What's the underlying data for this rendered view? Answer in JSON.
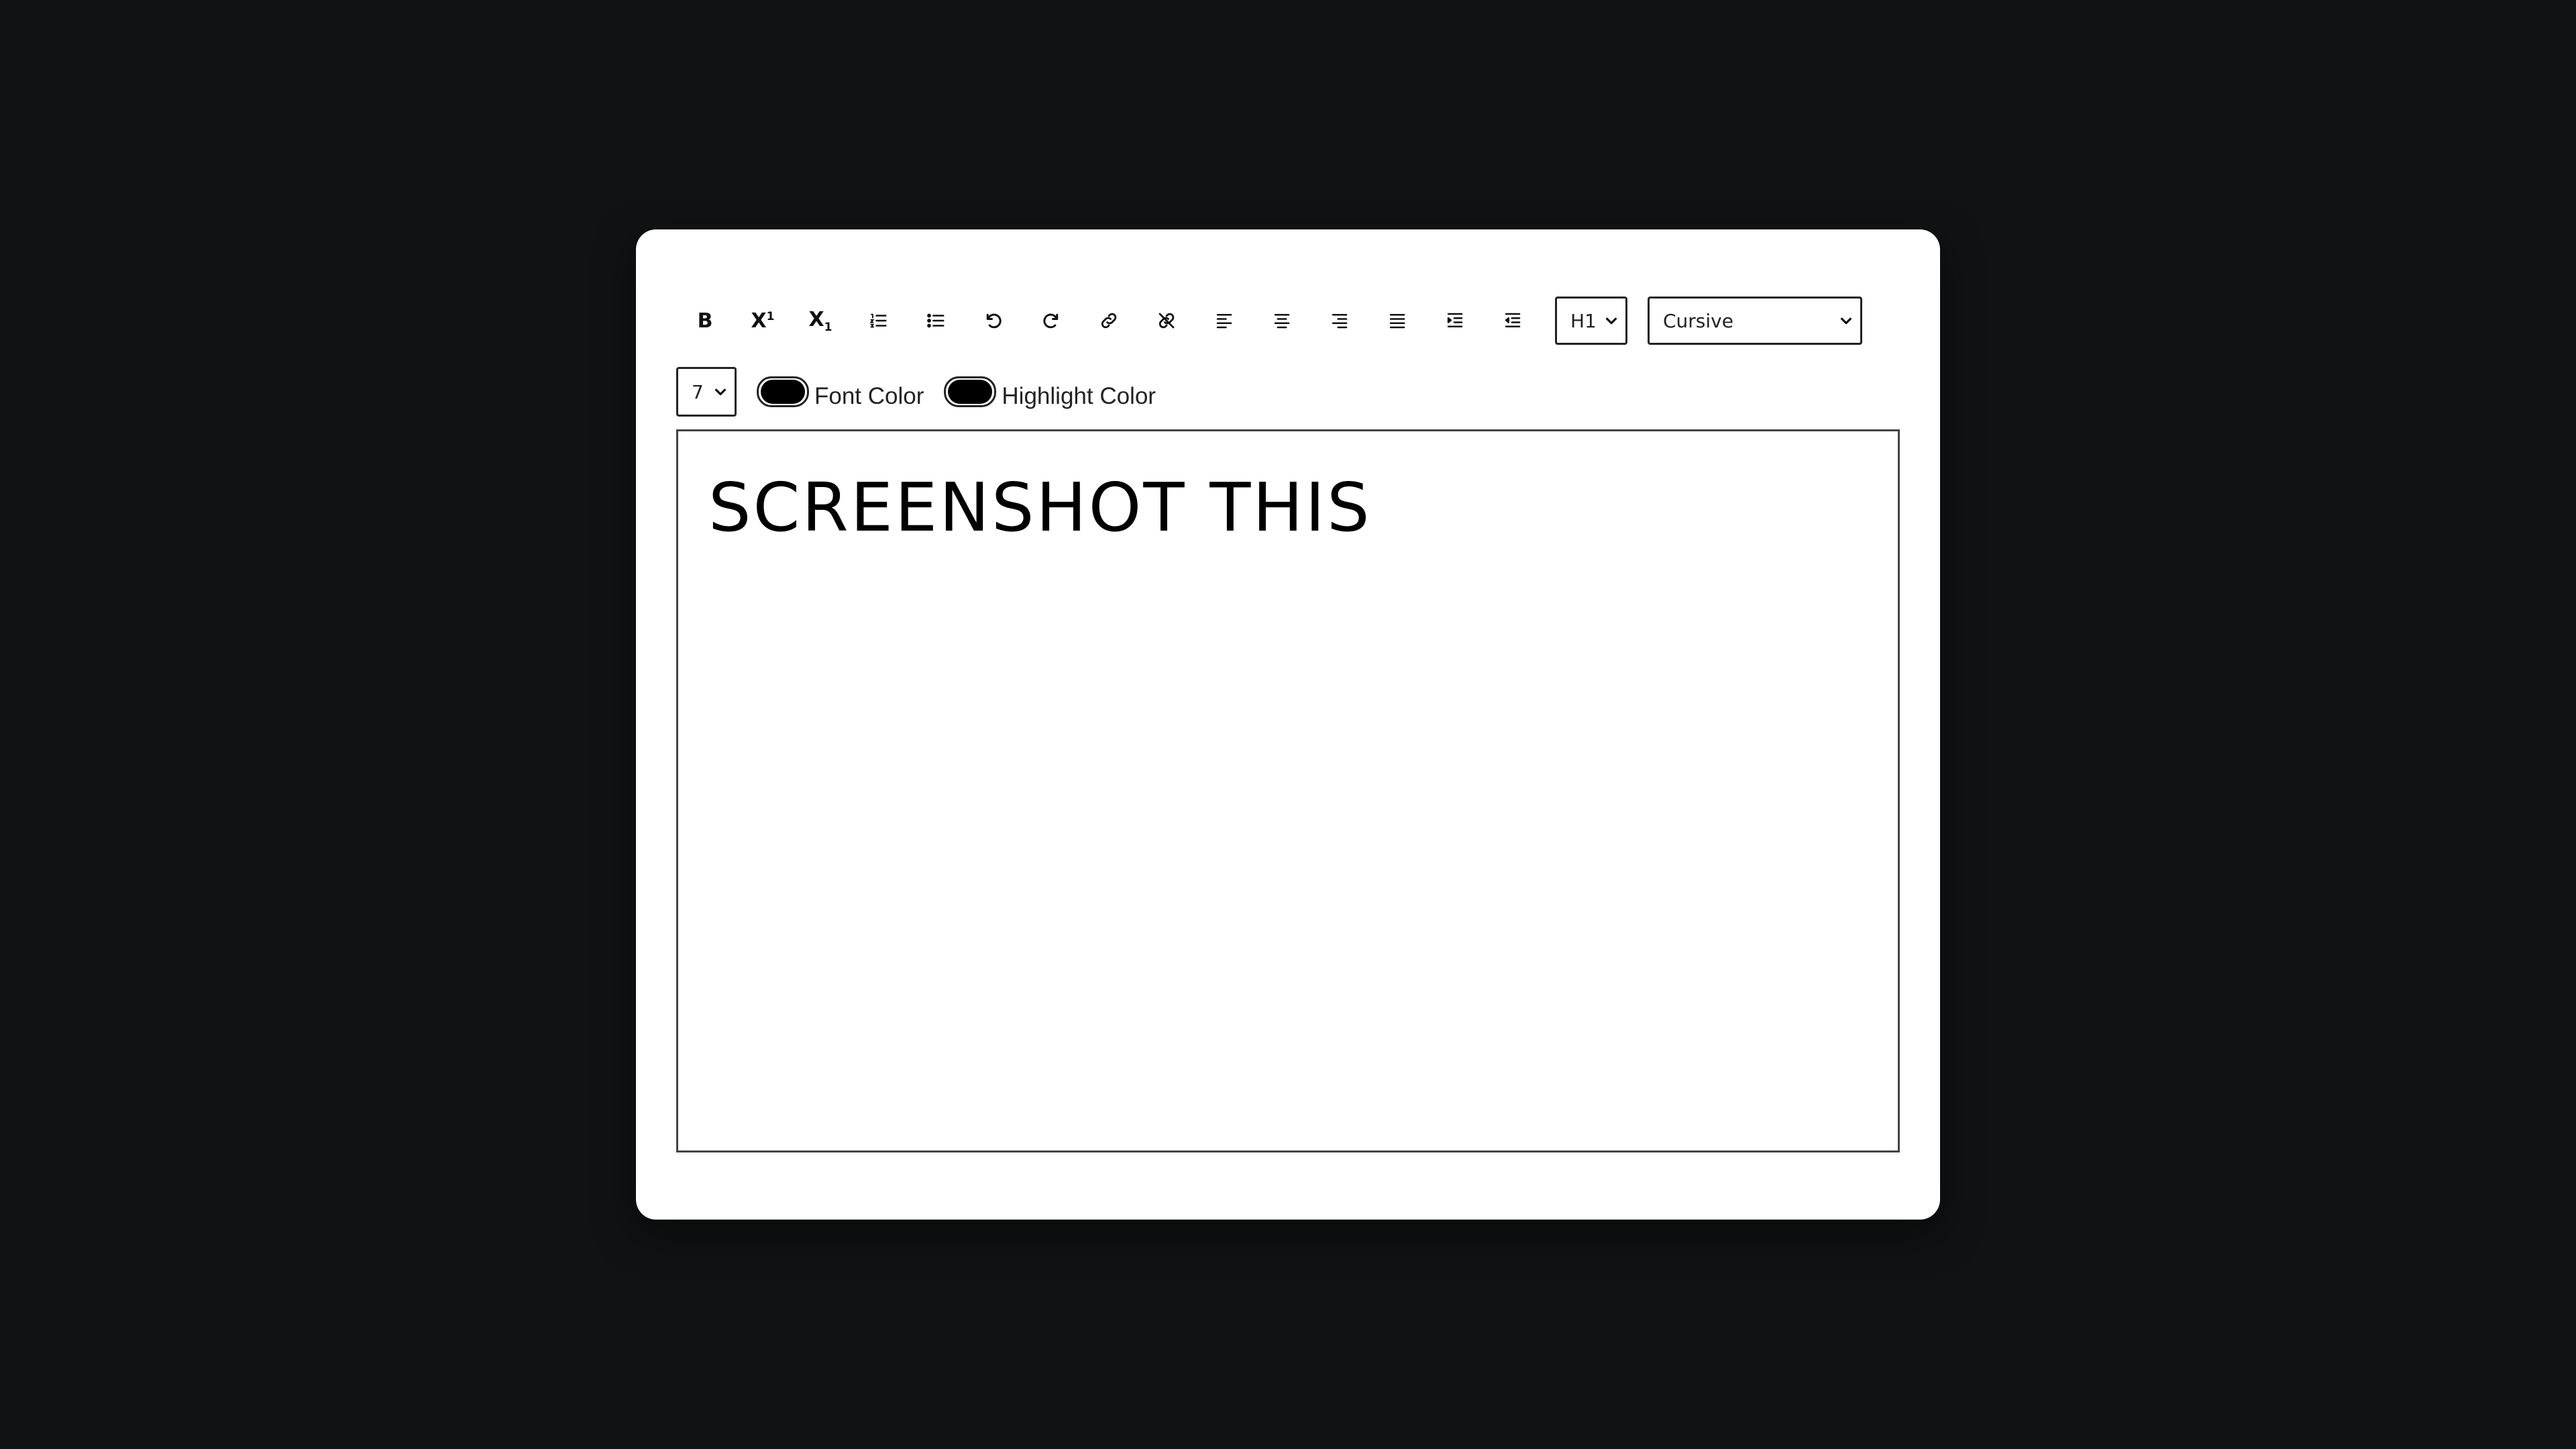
{
  "toolbar": {
    "bold_label": "B",
    "superscript_label": "X",
    "superscript_mark": "1",
    "subscript_label": "X",
    "subscript_mark": "1",
    "buttons": [
      "bold-icon",
      "superscript-icon",
      "subscript-icon",
      "ordered-list-icon",
      "unordered-list-icon",
      "undo-icon",
      "redo-icon",
      "link-icon",
      "unlink-icon",
      "align-left-icon",
      "align-center-icon",
      "align-right-icon",
      "align-justify-icon",
      "indent-icon",
      "outdent-icon"
    ],
    "heading_select": {
      "value": "H1"
    },
    "font_select": {
      "value": "Cursive"
    },
    "size_select": {
      "value": "7"
    },
    "font_color": {
      "label": "Font Color",
      "value": "#000000"
    },
    "highlight_color": {
      "label": "Highlight Color",
      "value": "#000000"
    }
  },
  "editor": {
    "content": "SCREENSHOT THIS"
  },
  "colors": {
    "page_background": "#111213",
    "card_background": "#ffffff"
  }
}
